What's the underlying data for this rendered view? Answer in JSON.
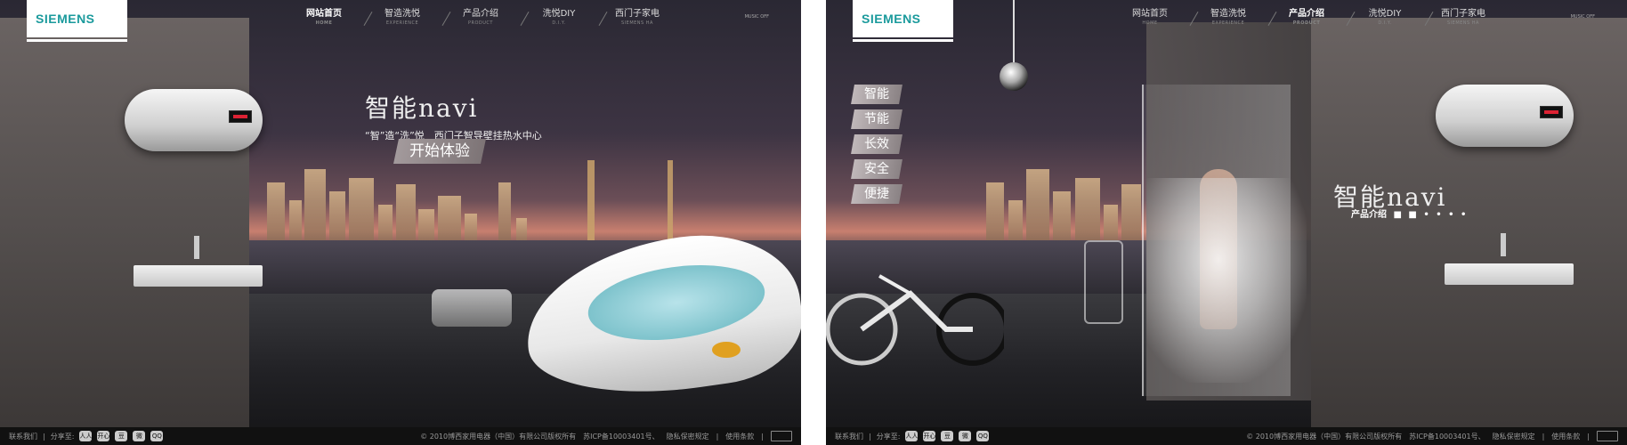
{
  "brand": "SIEMENS",
  "nav": [
    {
      "label": "网站首页",
      "sub": "HOME"
    },
    {
      "label": "智造洗悦",
      "sub": "EXPERIENCE"
    },
    {
      "label": "产品介绍",
      "sub": "PRODUCT"
    },
    {
      "label": "洗悦DIY",
      "sub": "D.I.Y."
    },
    {
      "label": "西门子家电",
      "sub": "SIEMENS HA"
    }
  ],
  "music": "MUSIC OFF",
  "panel1": {
    "active_nav": 0,
    "slogan_title": "智能navi",
    "slogan_sub": "“智”造“洗”悦　西门子智导壁挂热水中心",
    "start_button": "开始体验"
  },
  "panel2": {
    "active_nav": 2,
    "side_menu": [
      "智能",
      "节能",
      "长效",
      "安全",
      "便捷"
    ],
    "slogan_title": "智能navi",
    "product_label": "产品介绍",
    "dots": "■ ■ • • • •"
  },
  "footer": {
    "contact": "联系我们",
    "share": "分享至:",
    "share_icons": [
      "人人",
      "开心",
      "豆",
      "微",
      "QQ"
    ],
    "copyright": "© 2010博西家用电器（中国）有限公司版权所有",
    "icp": "苏ICP备10003401号、",
    "privacy": "隐私保密规定",
    "terms": "使用条款"
  }
}
